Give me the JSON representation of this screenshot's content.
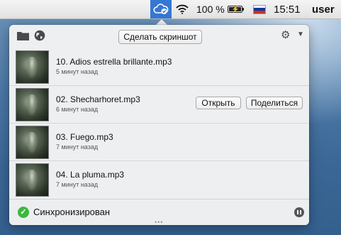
{
  "menubar": {
    "app_icon": "cloud-sync-icon",
    "wifi_icon": "wifi-icon",
    "battery_text": "100 %",
    "battery_level": 1.0,
    "flag_icon": "russian-flag-icon",
    "flag_colors": [
      "#ffffff",
      "#0039a6",
      "#d52b1e"
    ],
    "time": "15:51",
    "user": "user"
  },
  "toolbar": {
    "folder_icon": "folder-icon",
    "globe_icon": "globe-icon",
    "screenshot_label": "Сделать скриншот",
    "settings_icon": "gear-icon",
    "menu_icon": "chevron-down-icon"
  },
  "files": [
    {
      "name": "10. Adios estrella brillante.mp3",
      "time": "5 минут назад"
    },
    {
      "name": "02. Shecharhoret.mp3",
      "time": "6 минут назад",
      "open_label": "Открыть",
      "share_label": "Поделиться"
    },
    {
      "name": "03. Fuego.mp3",
      "time": "7 минут назад"
    },
    {
      "name": "04. La pluma.mp3",
      "time": "7 минут назад"
    }
  ],
  "footer": {
    "status_icon": "check-icon",
    "status_label": "Синхронизирован",
    "pause_icon": "pause-icon",
    "status_color": "#3db83f"
  }
}
